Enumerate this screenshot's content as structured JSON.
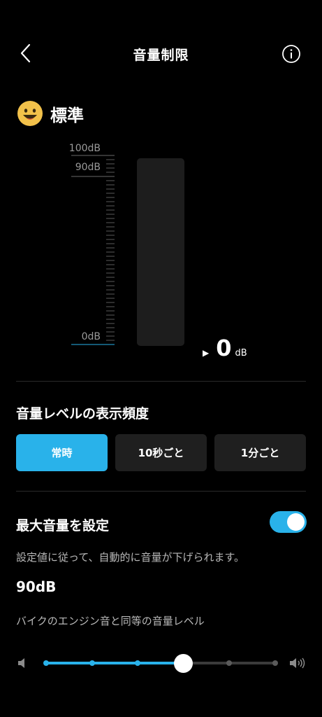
{
  "header": {
    "title": "音量制限",
    "back_icon": "chevron-left-icon",
    "info_icon": "info-circle-icon"
  },
  "mode": {
    "emoji": "grinning-face-icon",
    "label": "標準"
  },
  "meter": {
    "scale_labels": [
      "100dB",
      "90dB",
      "0dB"
    ],
    "current_value": "0",
    "current_unit": "dB",
    "level_fraction": 0
  },
  "frequency": {
    "title": "音量レベルの表示頻度",
    "options": [
      "常時",
      "10秒ごと",
      "1分ごと"
    ],
    "selected_index": 0
  },
  "max_volume": {
    "title": "最大音量を設定",
    "enabled": true,
    "description": "設定値に従って、自動的に音量が下げられます。",
    "value": "90dB",
    "caption": "バイクのエンジン音と同等の音量レベル",
    "slider_steps": 6,
    "slider_index": 3
  },
  "colors": {
    "accent": "#29b2ea",
    "background": "#000000",
    "segment_inactive": "#1f1f1f"
  }
}
